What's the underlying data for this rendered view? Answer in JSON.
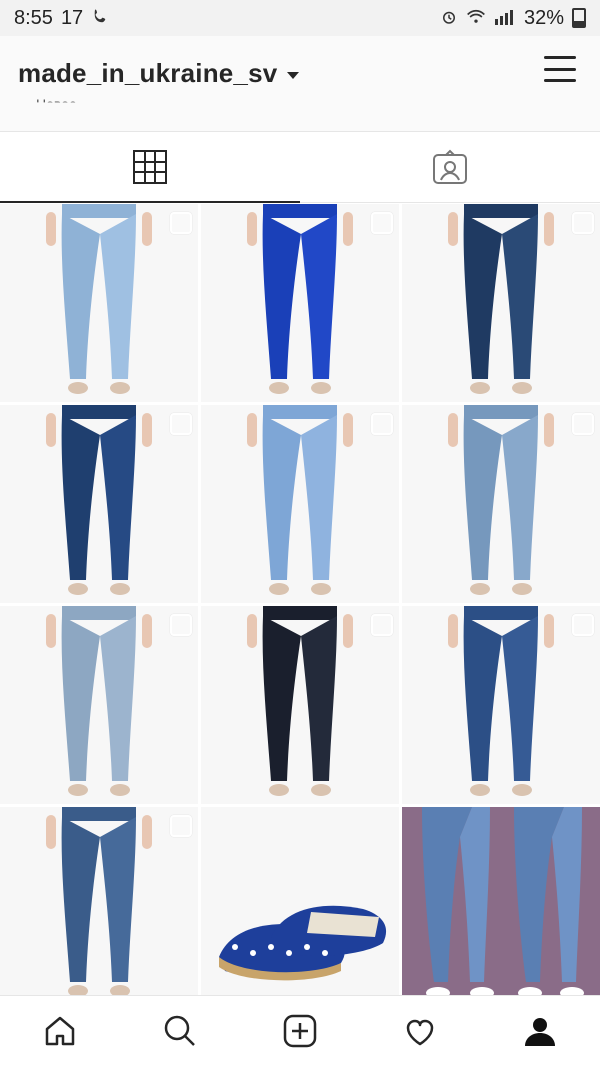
{
  "status_bar": {
    "time": "8:55",
    "temp": "17",
    "battery_pct": "32%",
    "icons": [
      "phone-icon",
      "alarm-icon",
      "wifi-icon",
      "signal-icon",
      "battery-icon"
    ]
  },
  "header": {
    "username": "made_in_ukraine_sv",
    "partial_text": "Новое",
    "icons": [
      "chevron-down-icon",
      "menu-icon"
    ]
  },
  "tabs": [
    {
      "name": "grid",
      "icon": "grid-icon",
      "active": true
    },
    {
      "name": "tagged",
      "icon": "tagged-icon",
      "active": false
    }
  ],
  "posts": [
    {
      "index": 1,
      "colors": [
        "#8fb2d6",
        "#9fc0e2"
      ],
      "type": "jeans",
      "multiple": true
    },
    {
      "index": 2,
      "colors": [
        "#1a40b8",
        "#2148c7"
      ],
      "type": "jeans",
      "multiple": true
    },
    {
      "index": 3,
      "colors": [
        "#1f3a62",
        "#2a4a76"
      ],
      "type": "jeans",
      "multiple": true
    },
    {
      "index": 4,
      "colors": [
        "#1f3f6f",
        "#264a84"
      ],
      "type": "jeans",
      "multiple": true
    },
    {
      "index": 5,
      "colors": [
        "#7ea6d6",
        "#8fb3df"
      ],
      "type": "jeans",
      "multiple": true
    },
    {
      "index": 6,
      "colors": [
        "#7698bd",
        "#88a8cb"
      ],
      "type": "jeans",
      "multiple": true
    },
    {
      "index": 7,
      "colors": [
        "#8da7c2",
        "#9cb4ce"
      ],
      "type": "jeans",
      "multiple": true
    },
    {
      "index": 8,
      "colors": [
        "#1a1f2d",
        "#232a3a"
      ],
      "type": "jeans",
      "multiple": true
    },
    {
      "index": 9,
      "colors": [
        "#2c4f86",
        "#365b95"
      ],
      "type": "jeans",
      "multiple": true
    },
    {
      "index": 10,
      "colors": [
        "#3a5c8a",
        "#466a9a"
      ],
      "type": "jeans",
      "multiple": true
    },
    {
      "index": 11,
      "colors": [
        "#1e3f9b",
        "#e9e2d3"
      ],
      "type": "shoes",
      "multiple": false
    },
    {
      "index": 12,
      "colors": [
        "#5a7fb3",
        "#6f93c6"
      ],
      "type": "jeans-duo",
      "multiple": false
    }
  ],
  "bottom_nav": [
    {
      "name": "home",
      "icon": "home-icon"
    },
    {
      "name": "search",
      "icon": "search-icon"
    },
    {
      "name": "add",
      "icon": "add-post-icon"
    },
    {
      "name": "activity",
      "icon": "heart-icon"
    },
    {
      "name": "profile",
      "icon": "profile-icon"
    }
  ]
}
